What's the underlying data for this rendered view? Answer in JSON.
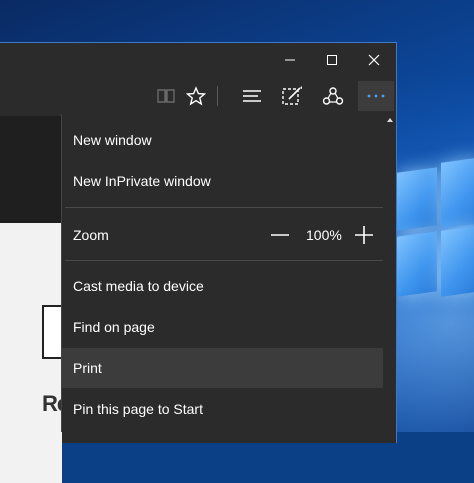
{
  "window": {
    "minimize_icon": "minimize-icon",
    "maximize_icon": "maximize-icon",
    "close_icon": "close-icon"
  },
  "toolbar": {
    "icons": [
      "reading-view-icon",
      "favorite-star-icon",
      "hub-icon",
      "web-note-icon",
      "share-icon",
      "more-actions-icon"
    ],
    "more_label": "···"
  },
  "page": {
    "partial_text": "Re"
  },
  "menu": {
    "new_window": "New window",
    "new_inprivate": "New InPrivate window",
    "zoom_label": "Zoom",
    "zoom_value": "100%",
    "cast_media": "Cast media to device",
    "find_on_page": "Find on page",
    "print": "Print",
    "pin_to_start": "Pin this page to Start"
  },
  "colors": {
    "menu_bg": "#2b2b2b",
    "menu_hover": "#3c3c3c",
    "accent": "#3d79c4"
  }
}
